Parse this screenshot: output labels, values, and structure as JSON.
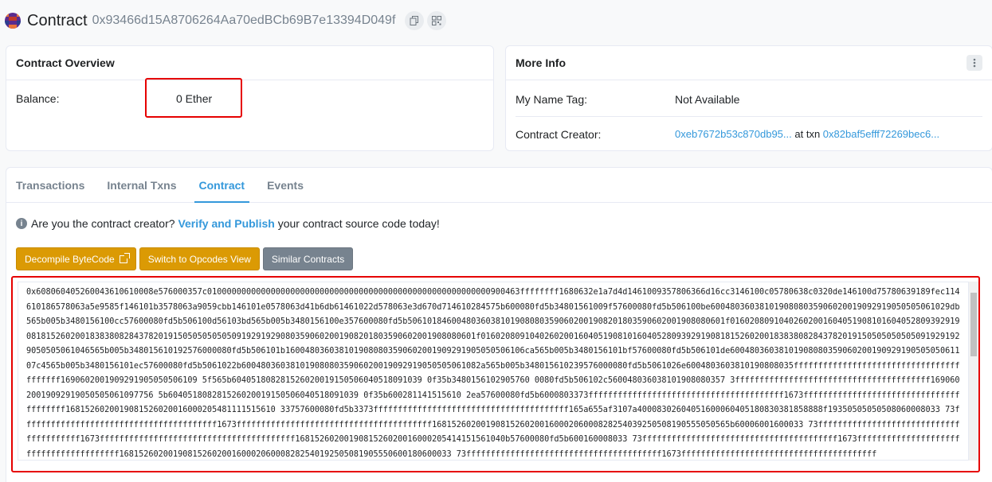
{
  "header": {
    "title": "Contract",
    "address": "0x93466d15A8706264Aa70edBCb69B7e13394D049f"
  },
  "overview": {
    "heading": "Contract Overview",
    "balance_label": "Balance:",
    "balance_value": "0 Ether"
  },
  "more_info": {
    "heading": "More Info",
    "name_tag_label": "My Name Tag:",
    "name_tag_value": "Not Available",
    "creator_label": "Contract Creator:",
    "creator_address": "0xeb7672b53c870db95...",
    "at_txn": "at txn",
    "creator_txn": "0x82baf5efff72269bec6..."
  },
  "tabs": [
    "Transactions",
    "Internal Txns",
    "Contract",
    "Events"
  ],
  "notice": {
    "prefix": "Are you the contract creator?",
    "link": "Verify and Publish",
    "suffix": "your contract source code today!"
  },
  "buttons": {
    "decompile": "Decompile ByteCode",
    "opcodes": "Switch to Opcodes View",
    "similar": "Similar Contracts"
  },
  "bytecode": "0x608060405260043610610008e576000357c0100000000000000000000000000000000000000000000000000000000900463ffffffff1680632e1a7d4d1461009357806366d16cc3146100c05780638c0320de146100d75780639189fec114610186578063a5e9585f146101b3578063a9059cbb146101e0578063d41b6db61461022d578063e3d670d714610284575b600080fd5b34801561009f57600080fd5b506100be6004803603810190808035906020019092919050505061029db565b005b3480156100cc57600080fd5b506100d56103bd565b005b3480156100e357600080fd5b50610184600480360381019080803590602001908201803590602001908080601f0160208091040260200160405190810160405280939291908181526020018383808284378201915050505050509192919290803590602001908201803590602001908080601f016020809104026020016040519081016040528093929190818152602001838380828437820191505050505050919291929050505061046565b005b348015610192576000080fd5b506101b1600480360381019080803590602001909291905050506106ca565b005b3480156101bf57600080fd5b506101de6004803603810190808035906020019092919050505061107c4565b005b3480156101ec57600080fd5b5061022b6004803603810190808035906020019092919050505061082a565b005b348015610239576000080fd5b5061026e6004803603810190808035fffffffffffffffffffffffffffffffffffffffff1690602001909291905050506109 5f565b604051808281526020019150506040518091039 0f35b3480156102905760 0080fd5b506102c560048036038101908080357 3ffffffffffffffffffffffffffffffffffffffff16906020019092919050505061097756 5b604051808281526020019150506040518091039 0f35b600281141515610 2ea57600080fd5b6000803373ffffffffffffffffffffffffffffffffffffffff1673ffffffffffffffffffffffffffffffffffffffff1681526020019081526020016000205481111515610 33757600080fd5b3373ffffffffffffffffffffffffffffffffffffffff165a655af3107a40008302604051600060405180830381858888f19350505050508060008033 73ffffffffffffffffffffffffffffffffffffffff1673ffffffffffffffffffffffffffffffffffffffff1681526020019081526020016000206000828254039250508190555050565b60006001600033 73ffffffffffffffffffffffffffffffffffffffff1673ffffffffffffffffffffffffffffffffffffffff1681526020019081526020016000205414151561040b57600080fd5b600160008033 73ffffffffffffffffffffffffffffffffffffffff1673ffffffffffffffffffffffffffffffffffffffff16815260200190815260200160002060008282540192505081905550600180600033 73ffffffffffffffffffffffffffffffffffffffff1673ffffffffffffffffffffffffffffffffffffffff"
}
